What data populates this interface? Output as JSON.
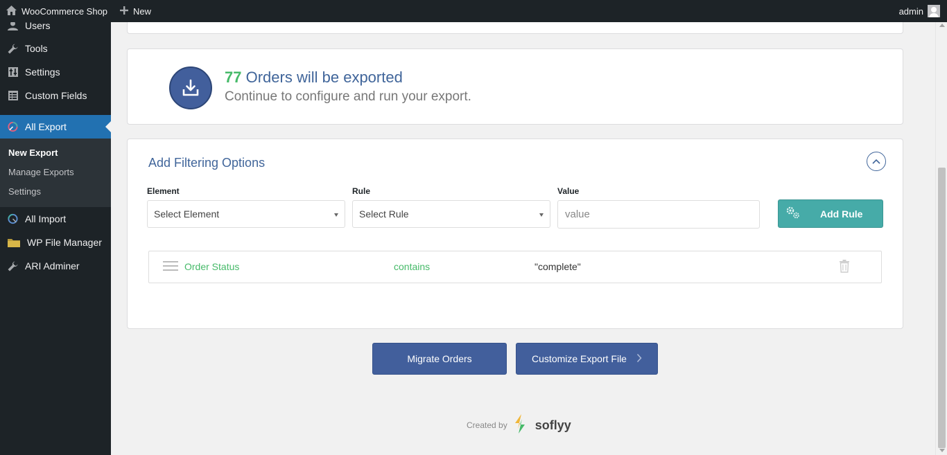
{
  "adminbar": {
    "site_name": "WooCommerce Shop",
    "new_label": "New",
    "account_name": "admin"
  },
  "sidebar": {
    "items": [
      {
        "label": "Users",
        "icon": "users-icon"
      },
      {
        "label": "Tools",
        "icon": "wrench-icon"
      },
      {
        "label": "Settings",
        "icon": "settings-icon"
      },
      {
        "label": "Custom Fields",
        "icon": "grid-icon"
      },
      {
        "label": "All Export",
        "icon": "all-export-icon",
        "active": true
      },
      {
        "label": "All Import",
        "icon": "all-import-icon"
      },
      {
        "label": "WP File Manager",
        "icon": "folder-icon"
      },
      {
        "label": "ARI Adminer",
        "icon": "wrench-icon"
      }
    ],
    "submenu": [
      {
        "label": "New Export",
        "current": true
      },
      {
        "label": "Manage Exports"
      },
      {
        "label": "Settings"
      }
    ]
  },
  "export_summary": {
    "count": "77",
    "headline": "Orders will be exported",
    "subtext": "Continue to configure and run your export."
  },
  "filtering": {
    "title": "Add Filtering Options",
    "element_label": "Element",
    "element_selected": "Select Element",
    "rule_label": "Rule",
    "rule_selected": "Select Rule",
    "value_label": "Value",
    "value_placeholder": "value",
    "add_rule_label": "Add Rule",
    "rules": [
      {
        "element": "Order Status",
        "condition": "contains",
        "value": "\"complete\""
      }
    ]
  },
  "actions": {
    "migrate_label": "Migrate Orders",
    "customize_label": "Customize Export File"
  },
  "footer": {
    "created_by": "Created by",
    "brand": "soflyy"
  },
  "colors": {
    "accent_blue": "#425f9c",
    "text_blue": "#40659a",
    "green": "#46ba69",
    "teal": "#46aba8",
    "wp_active": "#2271b1",
    "sidebar_bg": "#1d2327"
  }
}
